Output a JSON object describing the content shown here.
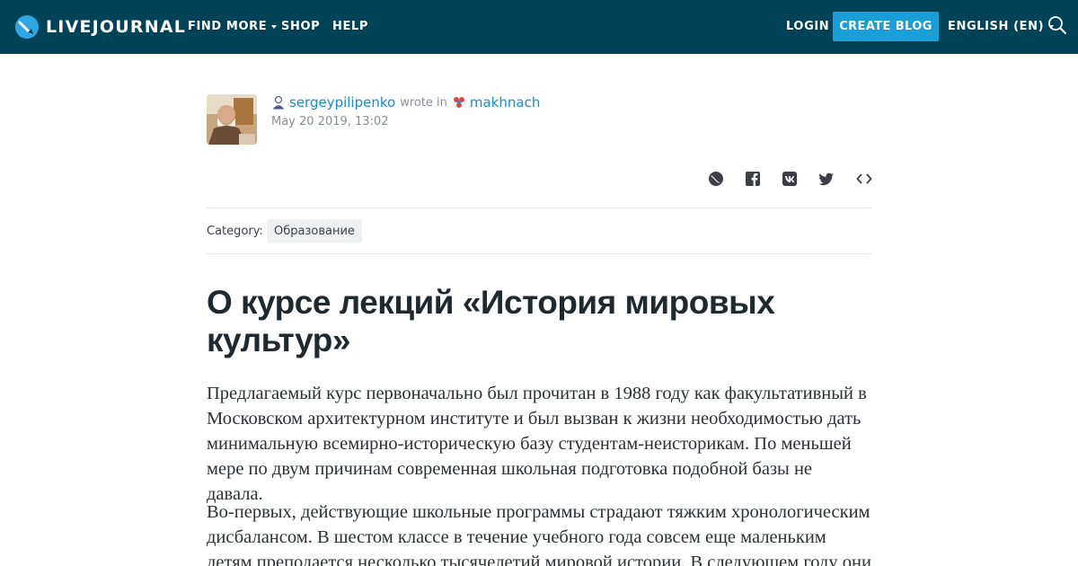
{
  "header": {
    "logo_text": "LIVEJOURNAL",
    "nav": [
      {
        "label": "FIND MORE",
        "has_dropdown": true
      },
      {
        "label": "SHOP",
        "has_dropdown": false
      },
      {
        "label": "HELP",
        "has_dropdown": false
      }
    ],
    "login_label": "LOGIN",
    "create_blog_label": "CREATE BLOG",
    "language_label": "ENGLISH (EN)",
    "background_color": "#004359",
    "accent_color": "#1a9ed8"
  },
  "post": {
    "author": "sergeypilipenko",
    "wrote_in": "wrote in",
    "community": "makhnach",
    "date": "May 20 2019, 13:02",
    "share_icons": [
      "livejournal-share-icon",
      "facebook-icon",
      "vk-icon",
      "twitter-icon",
      "embed-code-icon"
    ],
    "category_label": "Category:",
    "category": "Образование",
    "title": "О курсе лекций «История мировых культур»",
    "paragraphs": [
      "Предлагаемый курс первоначально был прочитан в 1988 году как факультативный в Московском архитектурном институте и был вызван к жизни необходимостью дать минимальную всемирно-историческую базу студентам-неисторикам. По меньшей мере по двум причинам современная школьная подготовка подобной базы не давала.",
      "Во-первых, действующие школьные программы страдают тяжким хронологическим дисбалансом. В шестом классе в течение учебного года совсем еще маленьким детям преподается несколько тысячелетий мировой истории. В следующем году они"
    ]
  }
}
